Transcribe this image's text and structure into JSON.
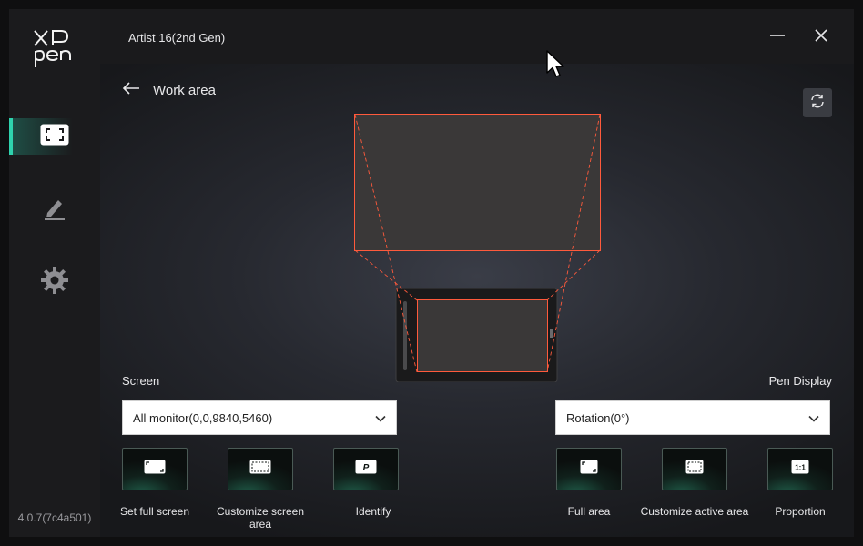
{
  "app": {
    "window_title": "Artist 16(2nd Gen)",
    "version": "4.0.7(7c4a501)",
    "logo_text": "XP pen"
  },
  "sidebar": {
    "items": [
      {
        "name": "work-area",
        "icon": "frame-icon",
        "active": true
      },
      {
        "name": "pen",
        "icon": "pen-icon",
        "active": false
      },
      {
        "name": "settings",
        "icon": "gear-icon",
        "active": false
      }
    ]
  },
  "header": {
    "back_label": "Work area"
  },
  "screen": {
    "label": "Screen",
    "selected": "All monitor(0,0,9840,5460)",
    "buttons": [
      {
        "label": "Set full screen",
        "icon": "full-screen-icon"
      },
      {
        "label": "Customize screen area",
        "icon": "customize-screen-icon"
      },
      {
        "label": "Identify",
        "icon": "identify-icon",
        "glyph": "P"
      }
    ]
  },
  "pen_display": {
    "label": "Pen Display",
    "selected": "Rotation(0°)",
    "buttons": [
      {
        "label": "Full area",
        "icon": "full-area-icon"
      },
      {
        "label": "Customize active area",
        "icon": "customize-active-icon"
      },
      {
        "label": "Proportion",
        "icon": "proportion-icon",
        "glyph": "1:1"
      }
    ]
  },
  "colors": {
    "accent": "#2fd3ae",
    "mapping_line": "#ff5a3c",
    "panel": "#1b1b1d"
  }
}
